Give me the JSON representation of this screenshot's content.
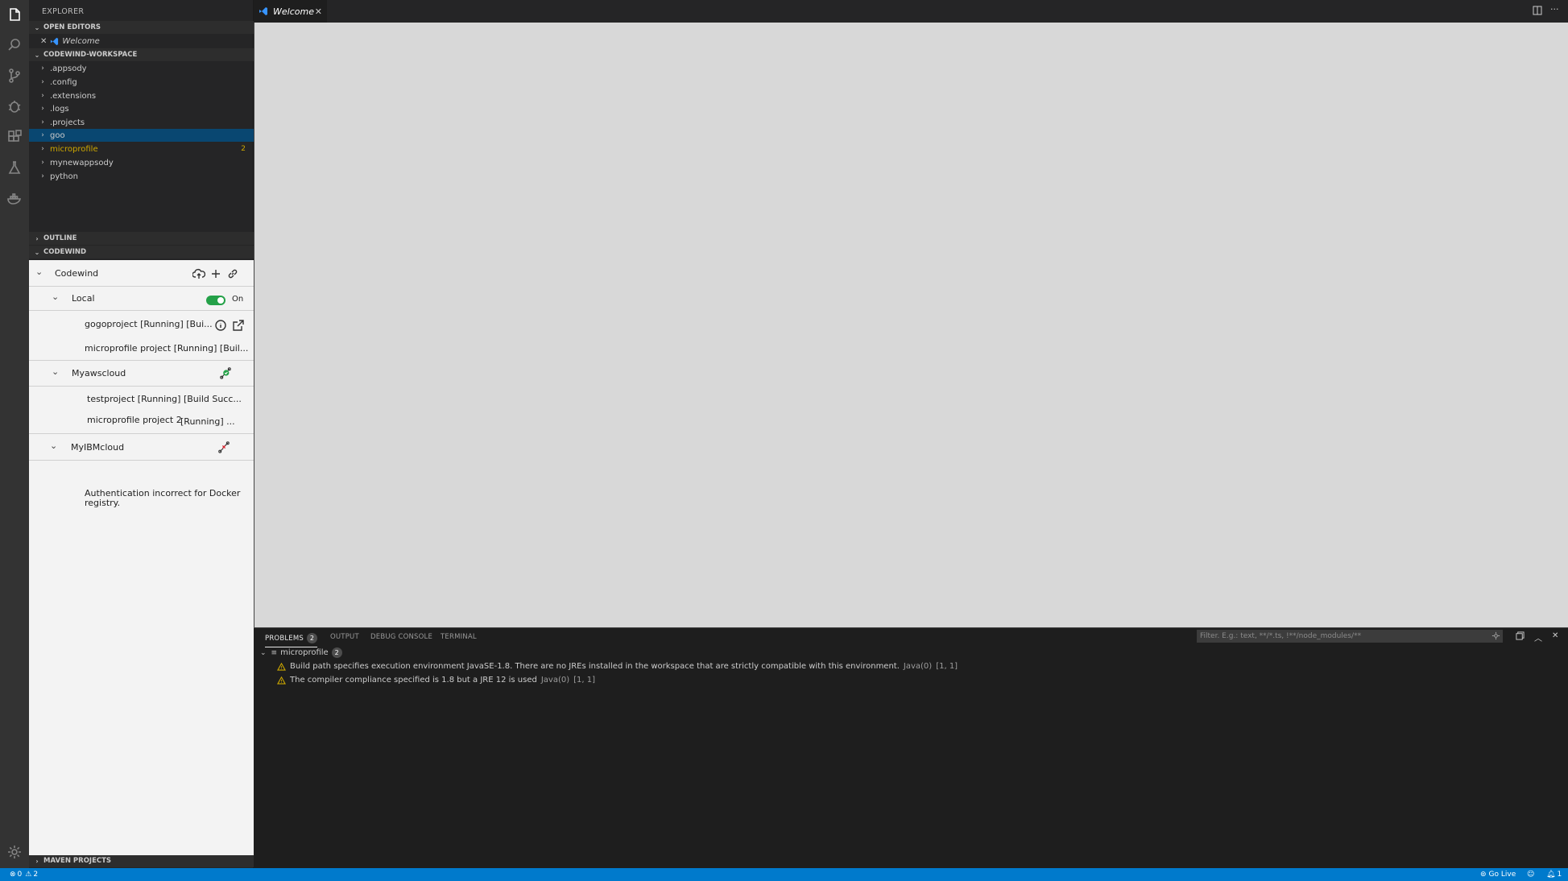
{
  "activity_bar": {
    "icons": [
      "files-icon",
      "search-icon",
      "source-control-icon",
      "debug-icon",
      "extensions-icon",
      "test-flask-icon",
      "docker-icon",
      "settings-gear-icon"
    ]
  },
  "sidebar": {
    "title": "EXPLORER",
    "open_editors": {
      "header": "OPEN EDITORS",
      "items": [
        {
          "label": "Welcome"
        }
      ]
    },
    "workspace": {
      "header": "CODEWIND-WORKSPACE",
      "items": [
        {
          "label": ".appsody"
        },
        {
          "label": ".config"
        },
        {
          "label": ".extensions"
        },
        {
          "label": ".logs"
        },
        {
          "label": ".projects"
        },
        {
          "label": "goo"
        },
        {
          "label": "microprofile",
          "count": "2"
        },
        {
          "label": "mynewappsody"
        },
        {
          "label": "python"
        }
      ]
    },
    "outline_header": "OUTLINE",
    "codewind_header": "CODEWIND",
    "maven_header": "MAVEN PROJECTS"
  },
  "codewind": {
    "root": "Codewind",
    "local": {
      "label": "Local",
      "toggle_label": "On",
      "projects": [
        "gogoproject  [Running] [Bui...",
        "microprofile project  [Running] [Buil..."
      ]
    },
    "myawscloud": {
      "label": "Myawscloud",
      "projects": [
        "testproject   [Running] [Build Succ...",
        "microprofile project 2",
        "[Running] ..."
      ]
    },
    "myibmcloud": {
      "label": "MyIBMcloud",
      "message": "Authentication incorrect for Docker registry."
    }
  },
  "editor": {
    "tab_label": "Welcome"
  },
  "panel": {
    "tabs": {
      "problems": "PROBLEMS",
      "problems_count": "2",
      "output": "OUTPUT",
      "debug_console": "DEBUG CONSOLE",
      "terminal": "TERMINAL"
    },
    "filter_placeholder": "Filter. E.g.: text, **/*.ts, !**/node_modules/**",
    "group": {
      "label": "microprofile",
      "count": "2"
    },
    "problems": [
      {
        "message": "Build path specifies execution environment JavaSE-1.8. There are no JREs installed in the workspace that are strictly compatible with this environment.",
        "source": "Java(0)",
        "location": "[1, 1]"
      },
      {
        "message": "The compiler compliance specified is 1.8 but a JRE 12 is used",
        "source": "Java(0)",
        "location": "[1, 1]"
      }
    ]
  },
  "statusbar": {
    "errors": "0",
    "warnings": "2",
    "go_live": "Go Live",
    "notifications": "1"
  },
  "colors": {
    "status_bar": "#007acc",
    "selection": "#094771",
    "warning": "#cca700",
    "toggle_on": "#24a148"
  }
}
